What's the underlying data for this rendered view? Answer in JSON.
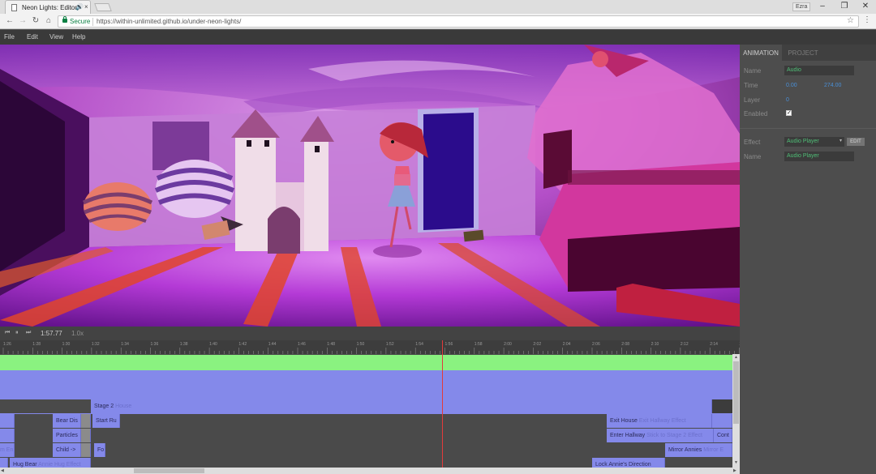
{
  "browser": {
    "tab_title": "Neon Lights: Editor",
    "audio_icon": "speaker-icon",
    "close_glyph": "×",
    "profile_label": "Ezra",
    "secure_label": "Secure",
    "url": "https://within-unlimited.github.io/under-neon-lights/",
    "window_controls": [
      "–",
      "❐",
      "✕"
    ],
    "nav_glyphs": {
      "back": "←",
      "forward": "→",
      "reload": "↻",
      "home": "⌂",
      "star": "☆",
      "menu": "⋮"
    }
  },
  "menubar": {
    "items": [
      "File",
      "Edit",
      "View",
      "Help"
    ]
  },
  "panel": {
    "tabs": [
      "ANIMATION",
      "PROJECT"
    ],
    "name_label": "Name",
    "name_value": "Audio",
    "time_label": "Time",
    "time_start": "0.00",
    "time_end": "274.00",
    "layer_label": "Layer",
    "layer_value": "0",
    "enabled_label": "Enabled",
    "enabled_mark": "✓",
    "effect_label": "Effect",
    "effect_value": "Audio Player",
    "effect_caret": "▾",
    "edit_label": "EDIT",
    "effect_name_label": "Name",
    "effect_name_value": "Audio Player"
  },
  "transport": {
    "controls": [
      "⏮",
      "⏸",
      "⏭"
    ],
    "time": "1:57.77",
    "speed": "1.0x"
  },
  "ruler": {
    "ticks": [
      "1:26",
      "1:28",
      "1:30",
      "1:32",
      "1:34",
      "1:36",
      "1:38",
      "1:40",
      "1:42",
      "1:44",
      "1:46",
      "1:48",
      "1:50",
      "1:52",
      "1:54",
      "1:56",
      "1:58",
      "2:00",
      "2:02",
      "2:04",
      "2:06",
      "2:08",
      "2:10",
      "2:12",
      "2:14",
      "2:16"
    ]
  },
  "timeline": {
    "clips": {
      "stage2": {
        "name": "Stage 2",
        "effect": "House"
      },
      "bear_dis": {
        "name": "Bear Dis",
        "effect": ""
      },
      "start_ru": {
        "name": "Start Ru",
        "effect": ""
      },
      "exit_house": {
        "name": "Exit House",
        "effect": "Exit Hallway Effect"
      },
      "m_en": {
        "name": "",
        "effect": "m En"
      },
      "particles": {
        "name": "Particles",
        "effect": ""
      },
      "enter_hallway": {
        "name": "Enter Hallway",
        "effect": "Stick to Stage 2 Effect"
      },
      "cont": {
        "name": "Cont",
        "effect": ""
      },
      "child": {
        "name": "Child ->",
        "effect": ""
      },
      "fo": {
        "name": "Fo",
        "effect": ""
      },
      "mirror_annies": {
        "name": "Mirror Annies",
        "effect": "Mirror E"
      },
      "hug_bear": {
        "name": "Hug Bear",
        "effect": "Annie Hug Effect"
      },
      "lock_annie": {
        "name": "Lock Annie's Direction",
        "effect": ""
      }
    }
  },
  "scroll_arrows": {
    "up": "▲",
    "down": "▼",
    "left": "◀",
    "right": "▶"
  },
  "colors": {
    "audio_track": "#8af280",
    "clip": "#8489ea",
    "playhead": "#e23b3b",
    "field_text": "#4fbf77",
    "number_text": "#4a8fd6"
  }
}
